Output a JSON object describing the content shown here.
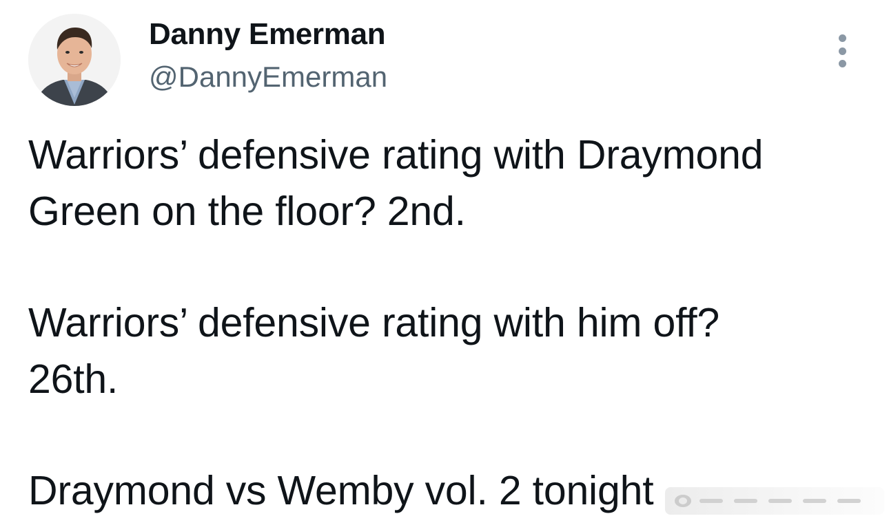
{
  "tweet": {
    "author": {
      "display_name": "Danny Emerman",
      "handle": "@DannyEmerman"
    },
    "more_icon": "more-vertical-icon",
    "paragraphs": [
      {
        "lines": [
          "Warriors’ defensive rating with Draymond",
          "Green on the floor? 2nd."
        ]
      },
      {
        "lines": [
          "Warriors’ defensive rating with him off?",
          "26th."
        ]
      },
      {
        "lines": [
          "Draymond vs Wemby vol. 2 tonight"
        ]
      }
    ]
  },
  "colors": {
    "text_primary": "#0f1419",
    "text_secondary": "#536471",
    "background": "#ffffff"
  }
}
